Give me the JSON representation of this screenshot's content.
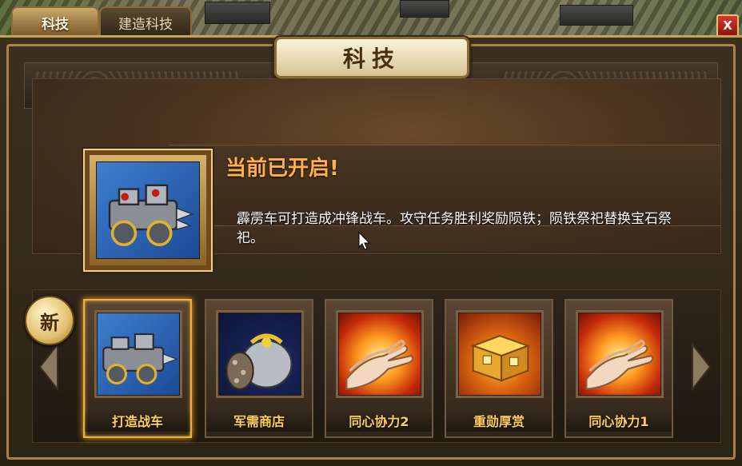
{
  "tabs": [
    {
      "label": "科技",
      "active": true
    },
    {
      "label": "建造科技",
      "active": false
    }
  ],
  "close_label": "X",
  "panel": {
    "title": "科技",
    "status": "当前已开启!",
    "description": "霹雳车可打造成冲锋战车。攻守任务胜利奖励陨铁；陨铁祭祀替换宝石祭祀。"
  },
  "new_badge": "新",
  "items": [
    {
      "label": "打造战车",
      "icon": "war-chariot-icon",
      "selected": true
    },
    {
      "label": "军需商店",
      "icon": "supply-bag-icon",
      "selected": false
    },
    {
      "label": "同心协力2",
      "icon": "flaming-hands-icon",
      "selected": false
    },
    {
      "label": "重勋厚赏",
      "icon": "treasure-chest-icon",
      "selected": false
    },
    {
      "label": "同心协力1",
      "icon": "flaming-hands-icon",
      "selected": false
    }
  ],
  "colors": {
    "accent_gold": "#f0b040",
    "status_orange": "#ffb04a",
    "label_yellow": "#ffd060",
    "close_red": "#d8392c"
  }
}
